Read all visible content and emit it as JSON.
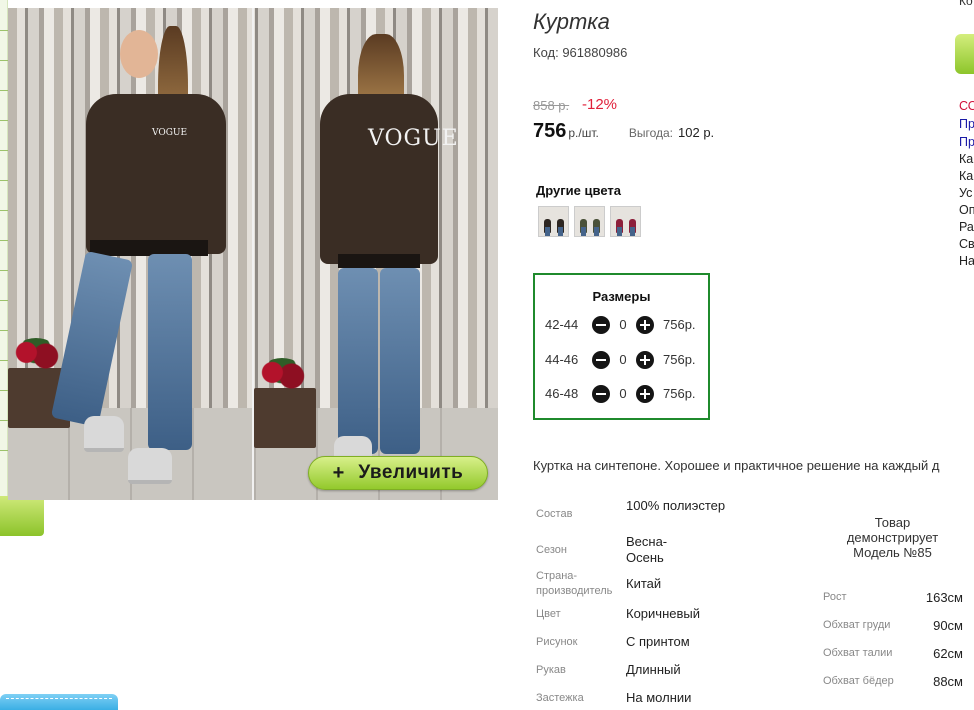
{
  "product": {
    "title": "Куртка",
    "code": "Код: 961880986",
    "old_price": "858 р.",
    "discount": "-12%",
    "price": "756",
    "price_unit": "р./шт.",
    "benefit_label": "Выгода:",
    "benefit_value": "102 р.",
    "zoom_button": {
      "plus": "+",
      "label": "Увеличить"
    },
    "photo_text": "VOGUE"
  },
  "colors": {
    "title": "Другие цвета",
    "swatches": [
      "swatch-dark",
      "swatch-green",
      "swatch-burgundy"
    ]
  },
  "sizes": {
    "title": "Размеры",
    "rows": [
      {
        "size": "42-44",
        "qty": "0",
        "price": "756р."
      },
      {
        "size": "44-46",
        "qty": "0",
        "price": "756р."
      },
      {
        "size": "46-48",
        "qty": "0",
        "price": "756р."
      }
    ]
  },
  "description": "Куртка на синтепоне. Хорошее и практичное решение на каждый д",
  "specs": [
    {
      "label": "Состав",
      "value": "100% полиэстер"
    },
    {
      "label": "Сезон",
      "value": "Весна-Осень"
    },
    {
      "label": "Страна-производитель",
      "value": "Китай"
    },
    {
      "label": "Цвет",
      "value": "Коричневый"
    },
    {
      "label": "Рисунок",
      "value": "С принтом"
    },
    {
      "label": "Рукав",
      "value": "Длинный"
    },
    {
      "label": "Застежка",
      "value": "На молнии"
    }
  ],
  "model": {
    "caption": "Товар демонстрирует Модель №85",
    "measurements": [
      {
        "label": "Рост",
        "value": "163см"
      },
      {
        "label": "Обхват груди",
        "value": "90см"
      },
      {
        "label": "Обхват талии",
        "value": "62см"
      },
      {
        "label": "Обхват бёдер",
        "value": "88см"
      }
    ]
  },
  "right_column": {
    "top_text": "Ко",
    "links": [
      {
        "text": "СО",
        "color": "#d0103a"
      },
      {
        "text": "Пр",
        "color": "#1a1aa6"
      },
      {
        "text": "Пр",
        "color": "#1a1aa6"
      },
      {
        "text": "Ка",
        "color": "#222222"
      },
      {
        "text": "Ка",
        "color": "#222222"
      },
      {
        "text": "Ус",
        "color": "#222222"
      },
      {
        "text": "Оп",
        "color": "#222222"
      },
      {
        "text": "Ра",
        "color": "#222222"
      },
      {
        "text": "Св",
        "color": "#222222"
      },
      {
        "text": "На",
        "color": "#222222"
      }
    ]
  },
  "colors_theme": {
    "accent_green": "#1f8a2c",
    "discount_red": "#e0203a",
    "button_green": "#93c92c"
  }
}
